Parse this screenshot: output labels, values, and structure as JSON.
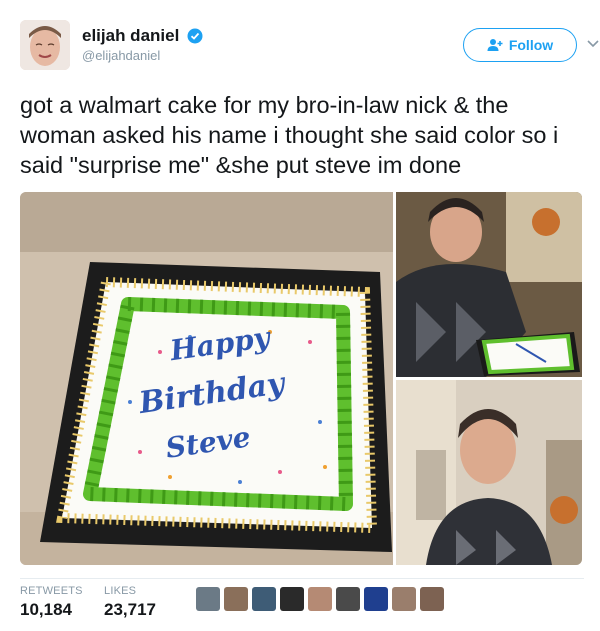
{
  "tweet": {
    "display_name": "elijah daniel",
    "handle": "@elijahdaniel",
    "verified": true,
    "text": "got a walmart cake for my bro-in-law nick & the woman asked his name i thought she said color so i said \"surprise me\" &she put steve im done"
  },
  "follow_button": {
    "label": "Follow",
    "icon": "add-user-icon"
  },
  "menu": {
    "icon": "chevron-down-icon"
  },
  "cake": {
    "line1": "Happy",
    "line2": "Birthday",
    "line3": "Steve"
  },
  "stats": {
    "retweets_label": "RETWEETS",
    "retweets_value": "10,184",
    "likes_label": "LIKES",
    "likes_value": "23,717"
  },
  "likers": [
    "#6b7a86",
    "#8a6f5a",
    "#3e5c76",
    "#2a2a2a",
    "#b58a74",
    "#4a4a4a",
    "#1f3f8f",
    "#9a7e6c",
    "#7d6252"
  ],
  "colors": {
    "accent": "#1da1f2",
    "text": "#14171a",
    "muted": "#8899a6",
    "frosting_green": "#5fbf2e",
    "frosting_blue": "#2f56b0"
  }
}
